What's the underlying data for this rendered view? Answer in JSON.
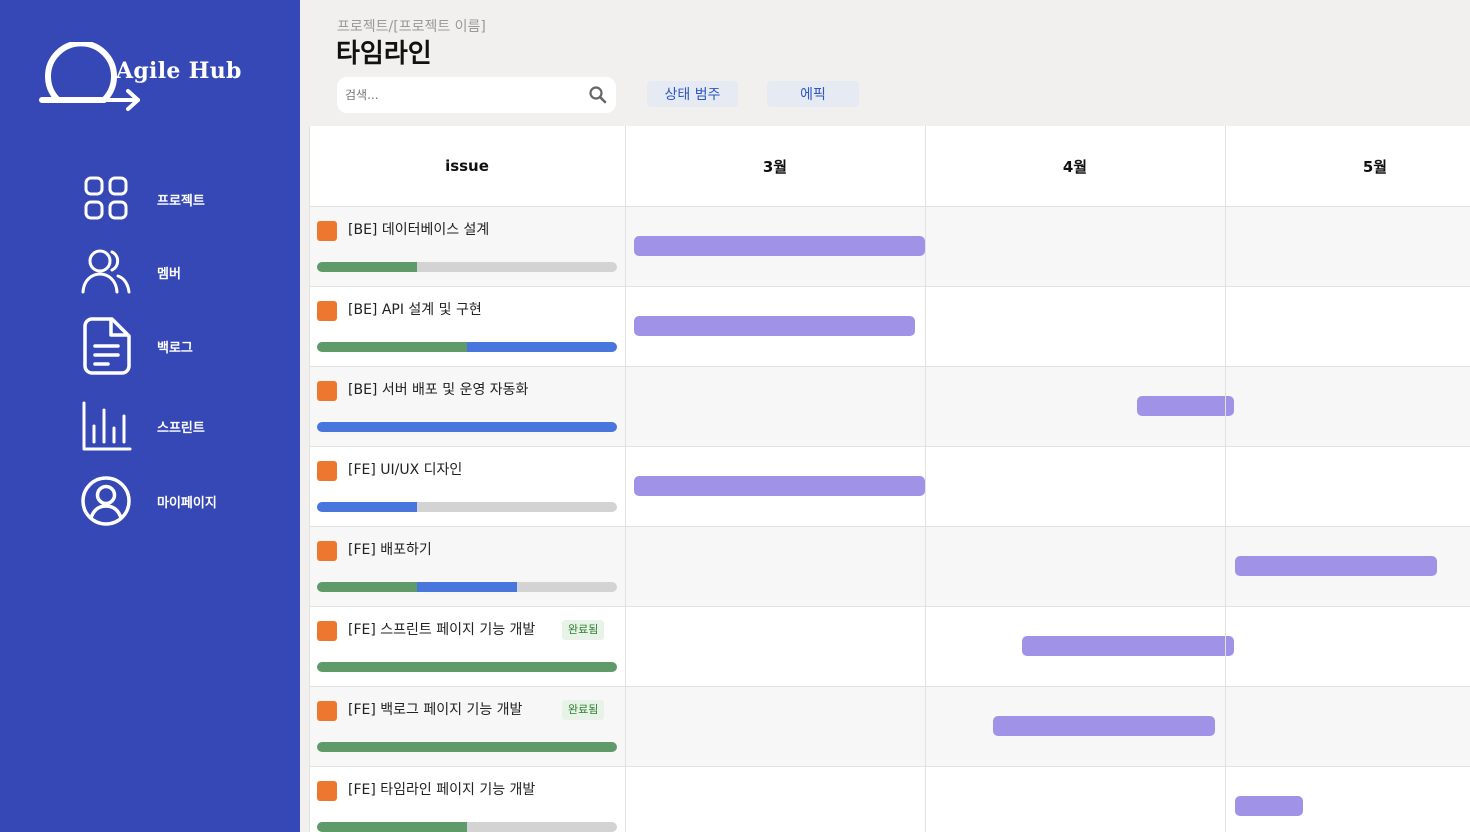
{
  "app": {
    "name": "Agile Hub"
  },
  "sidebar": {
    "items": [
      {
        "label": "프로젝트",
        "icon": "grid-icon"
      },
      {
        "label": "멤버",
        "icon": "users-icon"
      },
      {
        "label": "백로그",
        "icon": "document-icon"
      },
      {
        "label": "스프린트",
        "icon": "bar-chart-icon"
      },
      {
        "label": "마이페이지",
        "icon": "user-circle-icon"
      }
    ]
  },
  "header": {
    "breadcrumb": "프로젝트/[프로젝트 이름]",
    "title": "타임라인",
    "search_placeholder": "검색...",
    "filter_status": "상태 범주",
    "filter_epic": "에픽"
  },
  "colors": {
    "sidebar": "#3548b5",
    "marker": "#ee7730",
    "done": "#609a6b",
    "in_progress": "#4876dc",
    "todo": "#d3d3d3",
    "bar": "#a092e6"
  },
  "timeline": {
    "issue_header": "issue",
    "months": [
      "3월",
      "4월",
      "5월"
    ],
    "issues": [
      {
        "title": "[BE] 데이터베이스 설계",
        "badge": "",
        "progress": {
          "done": 0.333,
          "in_progress": 0
        },
        "start_month": 0.03,
        "end_month": 1.0
      },
      {
        "title": "[BE] API 설계 및 구현",
        "badge": "",
        "progress": {
          "done": 0.5,
          "in_progress": 0.5
        },
        "start_month": 0.03,
        "end_month": 0.967
      },
      {
        "title": "[BE] 서버 배포 및 운영 자동화",
        "badge": "",
        "progress": {
          "done": 0,
          "in_progress": 1.0
        },
        "start_month": 1.707,
        "end_month": 2.03
      },
      {
        "title": "[FE] UI/UX 디자인",
        "badge": "",
        "progress": {
          "done": 0,
          "in_progress": 0.333
        },
        "start_month": 0.03,
        "end_month": 1.0
      },
      {
        "title": "[FE] 배포하기",
        "badge": "",
        "progress": {
          "done": 0.333,
          "in_progress": 0.333
        },
        "start_month": 2.033,
        "end_month": 2.707
      },
      {
        "title": "[FE] 스프린트 페이지 기능 개발",
        "badge": "완료됨",
        "progress": {
          "done": 1.0,
          "in_progress": 0
        },
        "start_month": 1.323,
        "end_month": 2.03
      },
      {
        "title": "[FE] 백로그 페이지 기능 개발",
        "badge": "완료됨",
        "progress": {
          "done": 1.0,
          "in_progress": 0
        },
        "start_month": 1.227,
        "end_month": 1.967
      },
      {
        "title": "[FE] 타임라인 페이지 기능 개발",
        "badge": "",
        "progress": {
          "done": 0.5,
          "in_progress": 0
        },
        "start_month": 2.033,
        "end_month": 2.26
      }
    ]
  }
}
